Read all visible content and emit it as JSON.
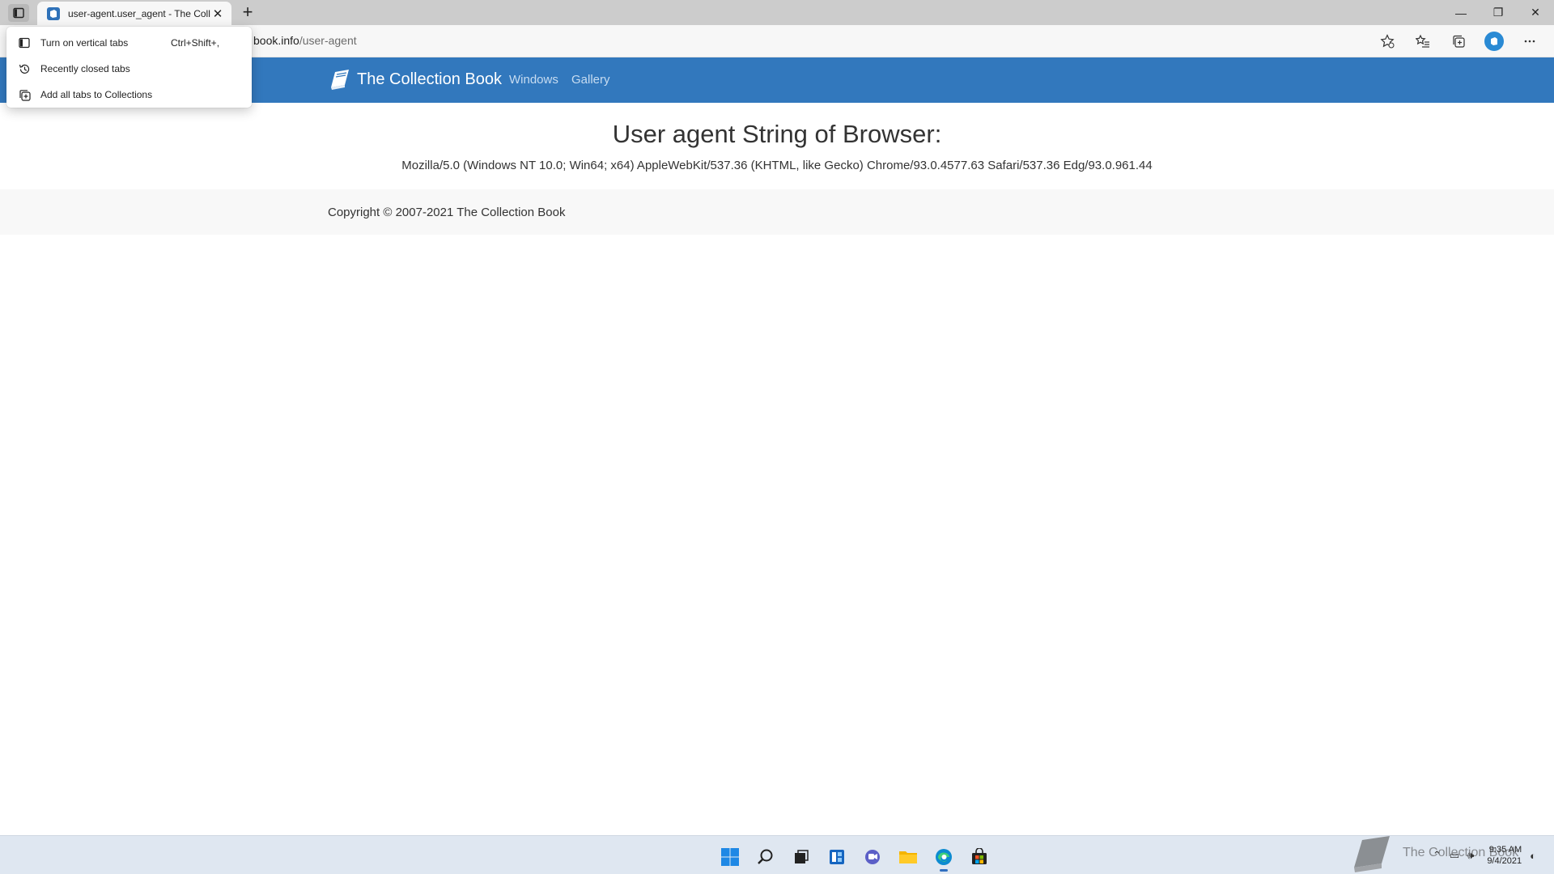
{
  "browser": {
    "tab_title": "user-agent.user_agent - The Coll",
    "tab_close": "✕",
    "new_tab": "+",
    "url_host": "book.info",
    "url_path": "/user-agent",
    "window_controls": {
      "minimize": "—",
      "restore": "❐",
      "close": "✕"
    }
  },
  "tab_menu": {
    "items": [
      {
        "label": "Turn on vertical tabs",
        "shortcut": "Ctrl+Shift+,",
        "icon": "vertical-tabs-icon"
      },
      {
        "label": "Recently closed tabs",
        "shortcut": "",
        "icon": "history-icon"
      },
      {
        "label": "Add all tabs to Collections",
        "shortcut": "",
        "icon": "collections-icon"
      }
    ]
  },
  "site": {
    "brand": "The Collection Book",
    "nav": [
      "Windows",
      "Gallery"
    ]
  },
  "content": {
    "title": "User agent String of Browser:",
    "user_agent": "Mozilla/5.0 (Windows NT 10.0; Win64; x64) AppleWebKit/537.36 (KHTML, like Gecko) Chrome/93.0.4577.63 Safari/537.36 Edg/93.0.961.44"
  },
  "footer": {
    "copyright": "Copyright © 2007-2021 The Collection Book"
  },
  "taskbar": {
    "time": "9:35 AM",
    "date": "9/4/2021",
    "watermark_text": "The Collection Book"
  },
  "colors": {
    "brand_blue": "#3278bd",
    "nav_link": "#c7dcf1",
    "tabstrip": "#cccccc",
    "taskbar": "#dfe7f1"
  }
}
